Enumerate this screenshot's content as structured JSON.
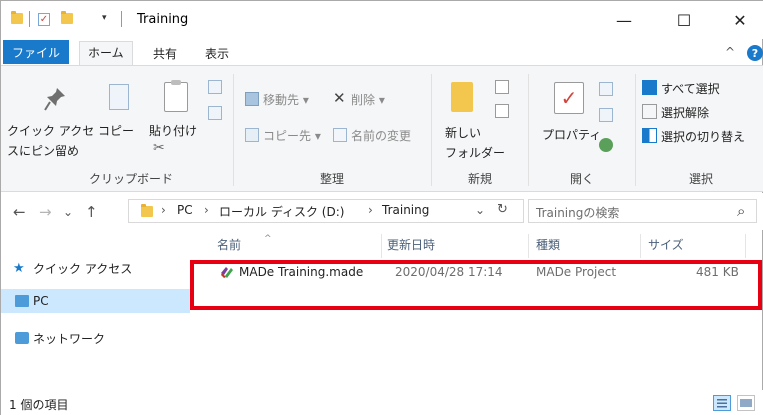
{
  "titlebar": {
    "title": "Training",
    "minimize": "—",
    "maximize": "☐",
    "close": "✕"
  },
  "ribbon_tabs": {
    "file": "ファイル",
    "home": "ホーム",
    "share": "共有",
    "view": "表示",
    "collapse": "^",
    "help": "?"
  },
  "ribbon": {
    "clipboard": {
      "pin_line1": "クイック アクセ",
      "pin_line2": "スにピン留め",
      "copy": "コピー",
      "paste": "貼り付け",
      "label": "クリップボード"
    },
    "organize": {
      "move_to": "移動先",
      "copy_to": "コピー先",
      "delete": "削除",
      "rename": "名前の変更",
      "label": "整理"
    },
    "new": {
      "new_folder_line1": "新しい",
      "new_folder_line2": "フォルダー",
      "label": "新規"
    },
    "open": {
      "properties": "プロパティ",
      "label": "開く"
    },
    "select": {
      "select_all": "すべて選択",
      "select_none": "選択解除",
      "invert": "選択の切り替え",
      "label": "選択"
    }
  },
  "address": {
    "back": "←",
    "forward": "→",
    "recent": "⌄",
    "up": "↑",
    "segments": [
      "PC",
      "ローカル ディスク (D:)",
      "Training"
    ],
    "separator": "›",
    "dropdown": "⌄",
    "refresh": "↻",
    "search_placeholder": "Trainingの検索",
    "search_icon": "⌕"
  },
  "nav_pane": {
    "items": [
      "クイック アクセス",
      "PC",
      "ネットワーク"
    ]
  },
  "columns": {
    "name": "名前",
    "date": "更新日時",
    "type": "種類",
    "size": "サイズ",
    "sort_caret": "^"
  },
  "files": [
    {
      "name": "MADe Training.made",
      "date": "2020/04/28 17:14",
      "type": "MADe Project",
      "size": "481 KB"
    }
  ],
  "status": {
    "count": "1 個の項目"
  },
  "colors": {
    "accent": "#1979ca",
    "highlight": "#e60012",
    "selection": "#cce8ff"
  }
}
